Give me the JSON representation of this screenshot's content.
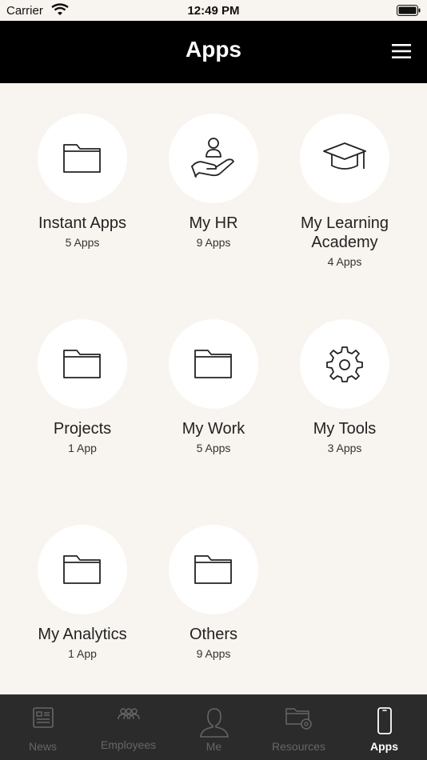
{
  "status_bar": {
    "carrier": "Carrier",
    "time": "12:49 PM"
  },
  "header": {
    "title": "Apps",
    "menu_icon": "hamburger-menu-icon"
  },
  "apps": [
    {
      "name": "Instant Apps",
      "count": "5 Apps",
      "icon": "folder-icon"
    },
    {
      "name": "My HR",
      "count": "9 Apps",
      "icon": "hand-person-icon"
    },
    {
      "name": "My Learning Academy",
      "count": "4 Apps",
      "icon": "graduation-cap-icon"
    },
    {
      "name": "Projects",
      "count": "1 App",
      "icon": "folder-icon"
    },
    {
      "name": "My Work",
      "count": "5 Apps",
      "icon": "folder-icon"
    },
    {
      "name": "My Tools",
      "count": "3 Apps",
      "icon": "gear-icon"
    },
    {
      "name": "My Analytics",
      "count": "1 App",
      "icon": "folder-icon"
    },
    {
      "name": "Others",
      "count": "9 Apps",
      "icon": "folder-icon"
    }
  ],
  "tabs": [
    {
      "label": "News",
      "icon": "news-icon"
    },
    {
      "label": "Employees",
      "icon": "employees-icon"
    },
    {
      "label": "Me",
      "icon": "person-icon"
    },
    {
      "label": "Resources",
      "icon": "resources-folder-icon"
    },
    {
      "label": "Apps",
      "icon": "phone-icon",
      "active": true
    }
  ],
  "colors": {
    "background": "#f8f4ef",
    "header": "#000000",
    "tab_bar": "#2b2b2b",
    "active_tab": "#ffffff",
    "inactive_tab": "#666666"
  }
}
